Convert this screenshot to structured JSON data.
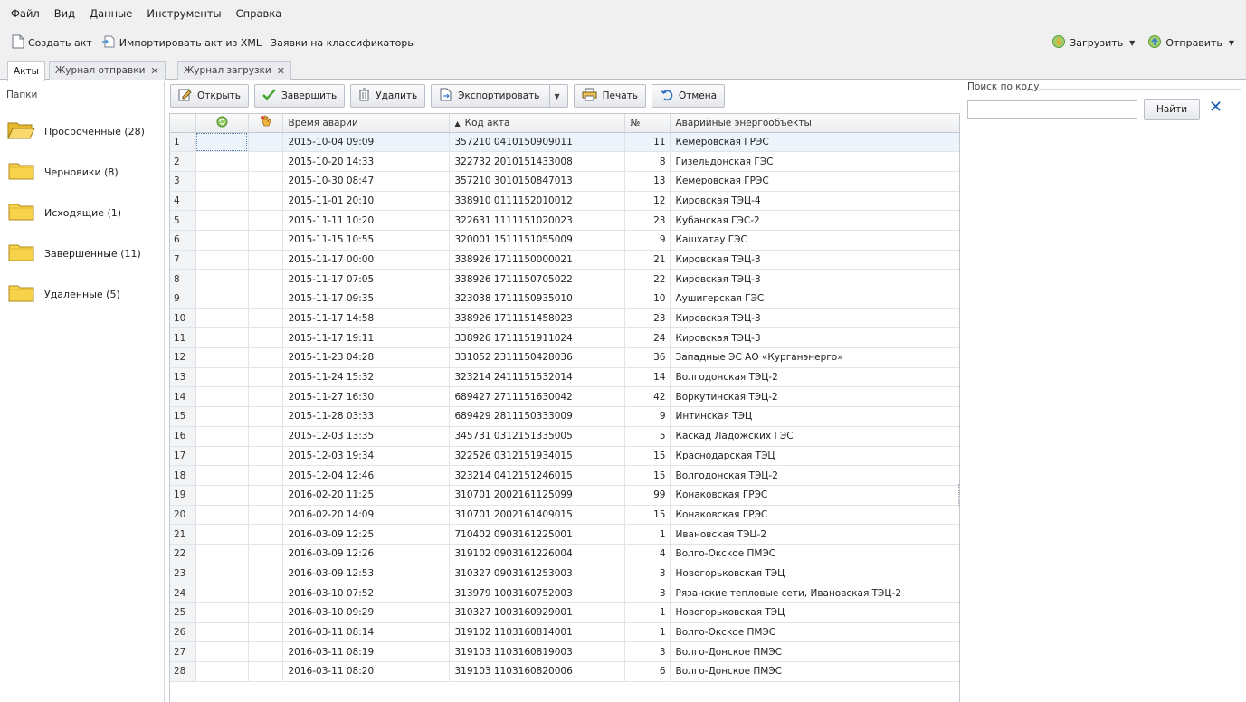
{
  "menu": [
    "Файл",
    "Вид",
    "Данные",
    "Инструменты",
    "Справка"
  ],
  "toolbar": {
    "create": "Создать акт",
    "import": "Импортировать акт из XML",
    "requests": "Заявки на классификаторы",
    "download": "Загрузить",
    "send": "Отправить"
  },
  "tabs": [
    {
      "label": "Акты",
      "closable": false
    },
    {
      "label": "Журнал отправки",
      "closable": true
    },
    {
      "label": "Журнал загрузки",
      "closable": true
    }
  ],
  "sidebar": {
    "title": "Папки",
    "folders": [
      {
        "label": "Просроченные (28)",
        "open": true
      },
      {
        "label": "Черновики (8)",
        "open": false
      },
      {
        "label": "Исходящие (1)",
        "open": false
      },
      {
        "label": "Завершенные (11)",
        "open": false
      },
      {
        "label": "Удаленные (5)",
        "open": false
      }
    ]
  },
  "grid_toolbar": {
    "open": "Открыть",
    "finish": "Завершить",
    "delete": "Удалить",
    "export": "Экспортировать",
    "print": "Печать",
    "cancel": "Отмена"
  },
  "table": {
    "headers": {
      "time": "Время аварии",
      "code": "Код акта",
      "no": "№",
      "objects": "Аварийные энергообъекты"
    },
    "rows": [
      [
        "1",
        "2015-10-04 09:09",
        "357210 0410150909011",
        "11",
        "Кемеровская ГРЭС"
      ],
      [
        "2",
        "2015-10-20 14:33",
        "322732 2010151433008",
        "8",
        "Гизельдонская ГЭС"
      ],
      [
        "3",
        "2015-10-30 08:47",
        "357210 3010150847013",
        "13",
        "Кемеровская ГРЭС"
      ],
      [
        "4",
        "2015-11-01 20:10",
        "338910 0111152010012",
        "12",
        "Кировская ТЭЦ-4"
      ],
      [
        "5",
        "2015-11-11 10:20",
        "322631 1111151020023",
        "23",
        "Кубанская ГЭС-2"
      ],
      [
        "6",
        "2015-11-15 10:55",
        "320001 1511151055009",
        "9",
        "Кашхатау ГЭС"
      ],
      [
        "7",
        "2015-11-17 00:00",
        "338926 1711150000021",
        "21",
        "Кировская ТЭЦ-3"
      ],
      [
        "8",
        "2015-11-17 07:05",
        "338926 1711150705022",
        "22",
        "Кировская ТЭЦ-3"
      ],
      [
        "9",
        "2015-11-17 09:35",
        "323038 1711150935010",
        "10",
        "Аушигерская ГЭС"
      ],
      [
        "10",
        "2015-11-17 14:58",
        "338926 1711151458023",
        "23",
        "Кировская ТЭЦ-3"
      ],
      [
        "11",
        "2015-11-17 19:11",
        "338926 1711151911024",
        "24",
        "Кировская ТЭЦ-3"
      ],
      [
        "12",
        "2015-11-23 04:28",
        "331052 2311150428036",
        "36",
        "Западные ЭС АО «Курганэнерго»"
      ],
      [
        "13",
        "2015-11-24 15:32",
        "323214 2411151532014",
        "14",
        "Волгодонская ТЭЦ-2"
      ],
      [
        "14",
        "2015-11-27 16:30",
        "689427 2711151630042",
        "42",
        "Воркутинская ТЭЦ-2"
      ],
      [
        "15",
        "2015-11-28 03:33",
        "689429 2811150333009",
        "9",
        "Интинская ТЭЦ"
      ],
      [
        "16",
        "2015-12-03 13:35",
        "345731 0312151335005",
        "5",
        "Каскад Ладожских ГЭС"
      ],
      [
        "17",
        "2015-12-03 19:34",
        "322526 0312151934015",
        "15",
        "Краснодарская ТЭЦ"
      ],
      [
        "18",
        "2015-12-04 12:46",
        "323214 0412151246015",
        "15",
        "Волгодонская ТЭЦ-2"
      ],
      [
        "19",
        "2016-02-20 11:25",
        "310701 2002161125099",
        "99",
        "Конаковская ГРЭС"
      ],
      [
        "20",
        "2016-02-20 14:09",
        "310701 2002161409015",
        "15",
        "Конаковская ГРЭС"
      ],
      [
        "21",
        "2016-03-09 12:25",
        "710402 0903161225001",
        "1",
        "Ивановская ТЭЦ-2"
      ],
      [
        "22",
        "2016-03-09 12:26",
        "319102 0903161226004",
        "4",
        "Волго-Окское ПМЭС"
      ],
      [
        "23",
        "2016-03-09 12:53",
        "310327 0903161253003",
        "3",
        "Новогорьковская ТЭЦ"
      ],
      [
        "24",
        "2016-03-10 07:52",
        "313979 1003160752003",
        "3",
        "Рязанские тепловые сети, Ивановская ТЭЦ-2"
      ],
      [
        "25",
        "2016-03-10 09:29",
        "310327 1003160929001",
        "1",
        "Новогорьковская ТЭЦ"
      ],
      [
        "26",
        "2016-03-11 08:14",
        "319102 1103160814001",
        "1",
        "Волго-Окское ПМЭС"
      ],
      [
        "27",
        "2016-03-11 08:19",
        "319103 1103160819003",
        "3",
        "Волго-Донское ПМЭС"
      ],
      [
        "28",
        "2016-03-11 08:20",
        "319103 1103160820006",
        "6",
        "Волго-Донское ПМЭС"
      ]
    ]
  },
  "search": {
    "legend": "Поиск по коду",
    "value": "",
    "find": "Найти"
  },
  "colors": {
    "accent": "#1f5fb6",
    "folder": "#f6d34a",
    "selection": "#eef4fc"
  }
}
